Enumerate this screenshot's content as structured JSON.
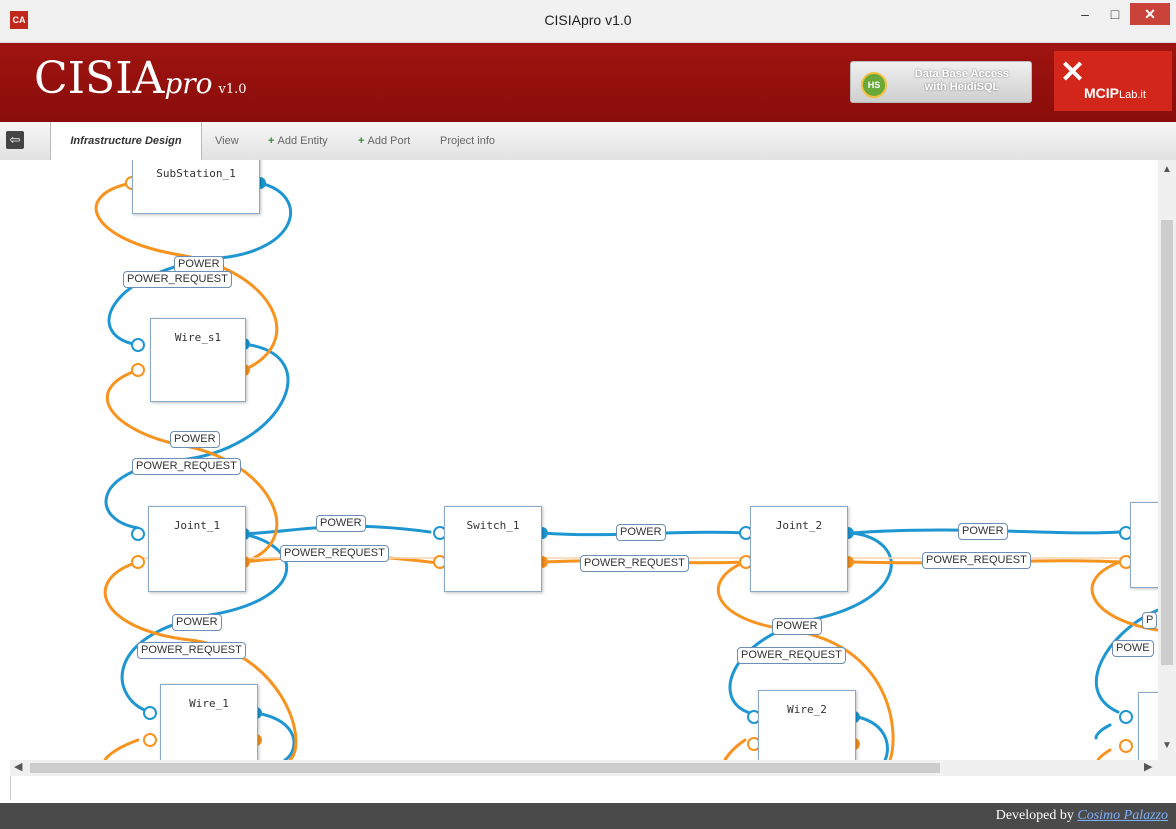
{
  "window": {
    "title": "CISIApro v1.0",
    "app_icon": "CA",
    "minimize": "–",
    "maximize": "□",
    "close": "✕"
  },
  "banner": {
    "logo_main": "CISIA",
    "logo_pro": "pro",
    "logo_version": "v1.0",
    "heidisql_icon": "HS",
    "heidisql_line1": "Data Base Access",
    "heidisql_line2": "with HeidiSQL",
    "mcip_main": "MCIP",
    "mcip_suffix": "Lab.it"
  },
  "toolbar": {
    "tabs": [
      "Infrastructure Design",
      "View",
      "Add Entity",
      "Add Port",
      "Project info"
    ]
  },
  "nodes": [
    "SubStation_1",
    "Wire_s1",
    "Joint_1",
    "Switch_1",
    "Joint_2",
    "Wire_1",
    "Wire_2"
  ],
  "edge_labels": {
    "power": "POWER",
    "power_request": "POWER_REQUEST"
  },
  "clipped_labels": {
    "power": "P",
    "power_request": "POWE"
  },
  "footer": {
    "prefix": "Developed by ",
    "author": "Cosimo Palazzo"
  },
  "colors": {
    "banner": "#9f1410",
    "power": "#1e96d2",
    "power_request": "#f7931e",
    "close": "#c9433b"
  }
}
